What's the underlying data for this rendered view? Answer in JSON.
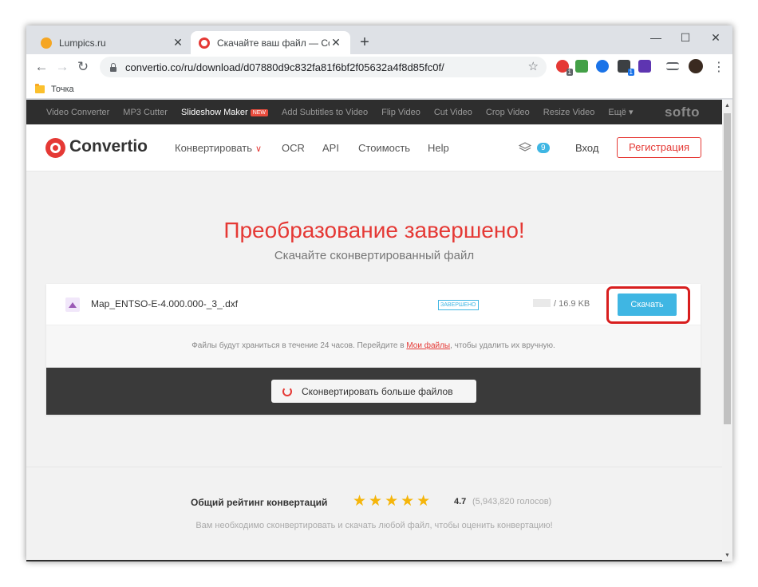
{
  "browser": {
    "tabs": [
      {
        "title": "Lumpics.ru",
        "close": "✕"
      },
      {
        "title": "Скачайте ваш файл — Convertio",
        "close": "✕"
      }
    ],
    "new_tab": "+",
    "window": {
      "minimize": "—",
      "maximize": "☐",
      "close": "✕"
    },
    "nav": {
      "back": "←",
      "forward": "→",
      "reload": "↻"
    },
    "url": "convertio.co/ru/download/d07880d9c832fa81f6bf2f05632a4f8d85fc0f/",
    "bookmark_star": "☆",
    "extension_badges": [
      "1",
      "1"
    ],
    "menu": "⋮",
    "bookmarks": [
      {
        "label": "Точка"
      }
    ]
  },
  "softo_bar": {
    "items": [
      "Video Converter",
      "MP3 Cutter",
      "Slideshow Maker",
      "Add Subtitles to Video",
      "Flip Video",
      "Cut Video",
      "Crop Video",
      "Resize Video",
      "Ещё ▾"
    ],
    "new_badge": "NEW",
    "logo": "softo"
  },
  "header": {
    "logo": "Convertio",
    "nav": [
      "Конвертировать",
      "OCR",
      "API",
      "Стоимость",
      "Help"
    ],
    "chevron": "∨",
    "stack_count": "9",
    "login": "Вход",
    "register": "Регистрация"
  },
  "main": {
    "title": "Преобразование завершено!",
    "subtitle": "Скачайте сконвертированный файл",
    "file": {
      "name": "Map_ENTSO-E-4.000.000-_3_.dxf",
      "status": "ЗАВЕРШЕНО",
      "size": "/ 16.9 KB",
      "download": "Скачать"
    },
    "retention": {
      "before": "Файлы будут храниться в течение 24 часов. Перейдите в ",
      "link": "Мои файлы",
      "after": ", чтобы удалить их вручную."
    },
    "convert_more": "Сконвертировать больше файлов"
  },
  "rating": {
    "label": "Общий рейтинг конвертаций",
    "stars": "★★★★★",
    "value": "4.7",
    "votes": "(5,943,820 голосов)",
    "note": "Вам необходимо сконвертировать и скачать любой файл, чтобы оценить конвертацию!"
  },
  "colors": {
    "brand": "#e53935",
    "accent": "#3fb6e3",
    "highlight": "#d81e1e"
  }
}
